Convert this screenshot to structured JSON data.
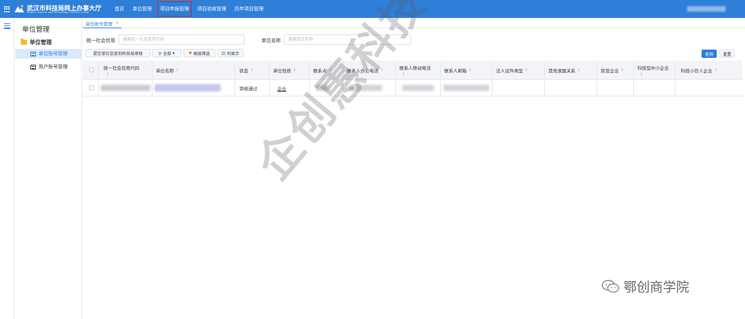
{
  "header": {
    "brand_title": "武汉市科技局网上办事大厅",
    "brand_subtitle": "Wuhan Science and Technology Service Center",
    "nav": [
      "首页",
      "单位管理",
      "项目申报管理",
      "项目验收管理",
      "历年项目管理"
    ],
    "highlighted_nav": "项目申报管理"
  },
  "sidebar": {
    "title": "单位管理",
    "group": "单位管理",
    "items": [
      {
        "label": "单位账号管理",
        "active": true
      },
      {
        "label": "用户账号管理",
        "active": false
      }
    ]
  },
  "tabs": [
    {
      "label": "单位账号管理",
      "close": "×"
    }
  ],
  "filters": {
    "credit_code_label": "统一社会信用",
    "credit_code_placeholder": "搜索统一社会信用代码",
    "unit_name_label": "单位名称",
    "unit_name_placeholder": "搜索单位名称",
    "credit_code_value": "",
    "unit_name_value": ""
  },
  "toolbar": {
    "submit_label": "提交单位信息到科技局审核",
    "all_label": "全部",
    "advanced_label": "高级筛选",
    "columns_label": "列显示",
    "search_label": "查询",
    "reset_label": "重置"
  },
  "table": {
    "columns": [
      "统一社会信用代码",
      "单位名称",
      "状态",
      "单位性质",
      "联系人",
      "联系人办公电话",
      "联系人移动电话",
      "联系人邮箱",
      "法人证件类型",
      "其他隶属关系",
      "民营企业",
      "科技型中小企业",
      "科技小巨人企业"
    ],
    "rows": [
      {
        "status": "审核通过",
        "nature": "企业"
      }
    ]
  },
  "watermark": "企创惠科技咨询",
  "brand_watermark": "鄂创商学院",
  "colors": {
    "primary": "#2e7fd8",
    "highlight_box": "#e02020",
    "active_bg": "#dbe9fb"
  }
}
